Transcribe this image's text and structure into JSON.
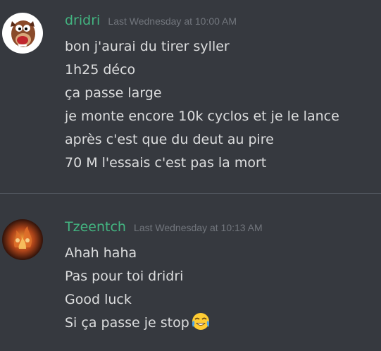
{
  "messages": [
    {
      "author": "dridri",
      "timestamp": "Last Wednesday at 10:00 AM",
      "lines": [
        "bon j'aurai du tirer syller",
        "1h25 déco",
        "ça passe large",
        "je monte encore 10k cyclos et je le lance",
        "après c'est que du deut au pire",
        "70 M l'essais c'est pas la mort"
      ]
    },
    {
      "author": "Tzeentch",
      "timestamp": "Last Wednesday at 10:13 AM",
      "lines": [
        "Ahah haha",
        "Pas pour toi dridri",
        "Good luck",
        "Si ça passe je stop"
      ],
      "emoji": "face-with-tears-of-joy-emoji"
    }
  ],
  "colors": {
    "background": "#36393f",
    "username": "#43b581",
    "timestamp": "#72767d",
    "text": "#dcddde",
    "divider": "#4f545c"
  }
}
